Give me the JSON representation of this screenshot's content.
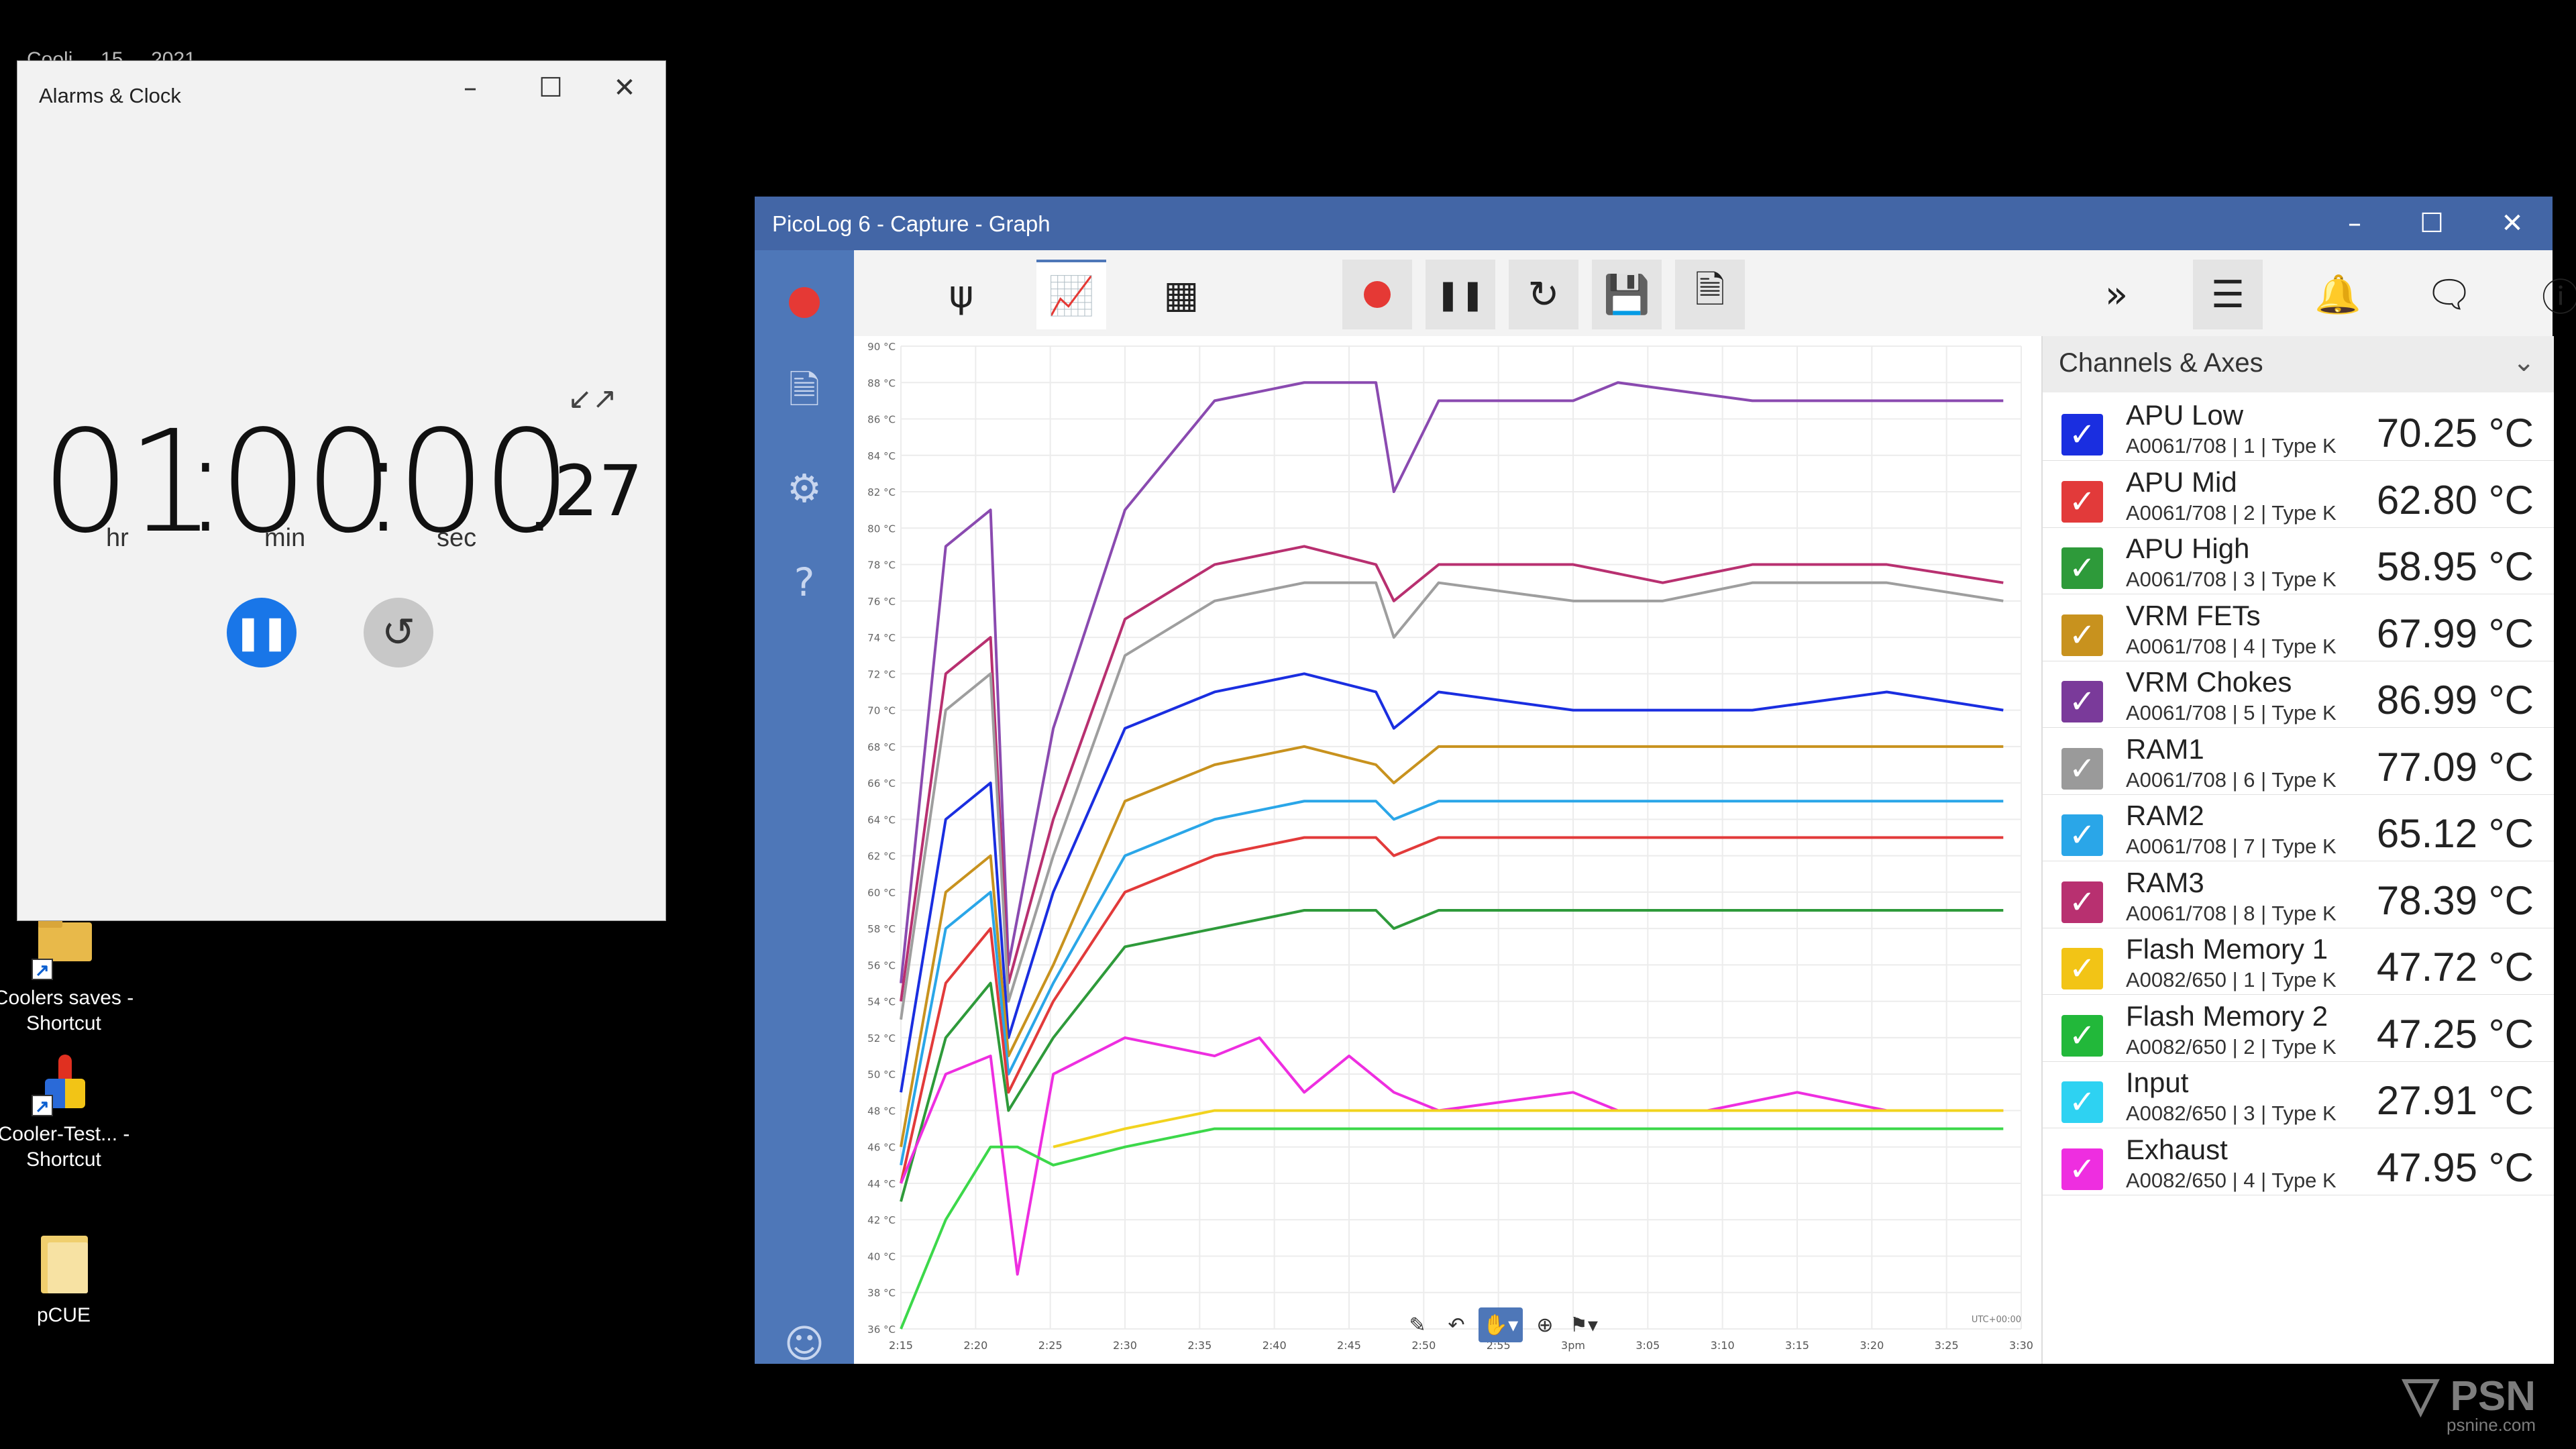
{
  "desktop": {
    "clipped_top_text": "Cooli ... 15 ... 2021",
    "icons": [
      {
        "label": "Coolers saves - Shortcut",
        "icon": "folder-icon"
      },
      {
        "label": "Cooler-Test... - Shortcut",
        "icon": "app-icon"
      },
      {
        "label": "pCUE",
        "icon": "folder-icon"
      }
    ],
    "watermark": "PSN",
    "watermark_sub": "psnine.com"
  },
  "clock": {
    "title": "Alarms & Clock",
    "hours": "01",
    "minutes": "00",
    "seconds": "00",
    "hundredths": "27",
    "sep": ":",
    "dot": ".",
    "unit_hr": "hr",
    "unit_min": "min",
    "unit_sec": "sec"
  },
  "picolog": {
    "title": "PicoLog 6 - Capture - Graph",
    "channels_header": "Channels & Axes",
    "channels": [
      {
        "name": "APU Low",
        "sub": "A0061/708 | 1 | Type K",
        "value": "70.25 °C",
        "color": "#1a2ee0"
      },
      {
        "name": "APU Mid",
        "sub": "A0061/708 | 2 | Type K",
        "value": "62.80 °C",
        "color": "#e23a3a"
      },
      {
        "name": "APU High",
        "sub": "A0061/708 | 3 | Type K",
        "value": "58.95 °C",
        "color": "#2e9a3a"
      },
      {
        "name": "VRM FETs",
        "sub": "A0061/708 | 4 | Type K",
        "value": "67.99 °C",
        "color": "#c8921e"
      },
      {
        "name": "VRM Chokes",
        "sub": "A0061/708 | 5 | Type K",
        "value": "86.99 °C",
        "color": "#7a3a9a"
      },
      {
        "name": "RAM1",
        "sub": "A0061/708 | 6 | Type K",
        "value": "77.09 °C",
        "color": "#9a9a9a"
      },
      {
        "name": "RAM2",
        "sub": "A0061/708 | 7 | Type K",
        "value": "65.12 °C",
        "color": "#2aa6e8"
      },
      {
        "name": "RAM3",
        "sub": "A0061/708 | 8 | Type K",
        "value": "78.39 °C",
        "color": "#b83070"
      },
      {
        "name": "Flash Memory 1",
        "sub": "A0082/650 | 1 | Type K",
        "value": "47.72 °C",
        "color": "#f2c416"
      },
      {
        "name": "Flash Memory 2",
        "sub": "A0082/650 | 2 | Type K",
        "value": "47.25 °C",
        "color": "#22b83a"
      },
      {
        "name": "Input",
        "sub": "A0082/650 | 3 | Type K",
        "value": "27.91 °C",
        "color": "#2ed2f2"
      },
      {
        "name": "Exhaust",
        "sub": "A0082/650 | 4 | Type K",
        "value": "47.95 °C",
        "color": "#ee2ee0"
      }
    ]
  },
  "chart_data": {
    "type": "line",
    "xlabel": "",
    "ylabel": "",
    "x_ticks": [
      "2:15",
      "2:20",
      "2:25",
      "2:30",
      "2:35",
      "2:40",
      "2:45",
      "2:50",
      "2:55",
      "3pm",
      "3:05",
      "3:10",
      "3:15",
      "3:20",
      "3:25",
      "3:30"
    ],
    "y_ticks": [
      "36 °C",
      "38 °C",
      "40 °C",
      "42 °C",
      "44 °C",
      "46 °C",
      "48 °C",
      "50 °C",
      "52 °C",
      "54 °C",
      "56 °C",
      "58 °C",
      "60 °C",
      "62 °C",
      "64 °C",
      "66 °C",
      "68 °C",
      "70 °C",
      "72 °C",
      "74 °C",
      "76 °C",
      "78 °C",
      "80 °C",
      "82 °C",
      "84 °C",
      "86 °C",
      "88 °C",
      "90 °C"
    ],
    "timezone": "UTC+00:00",
    "xlim": [
      2.25,
      3.5
    ],
    "ylim": [
      36,
      90
    ],
    "series": [
      {
        "name": "VRM Chokes",
        "color": "#8a4ab0",
        "points": [
          [
            2.25,
            55
          ],
          [
            2.3,
            79
          ],
          [
            2.35,
            81
          ],
          [
            2.37,
            56
          ],
          [
            2.42,
            69
          ],
          [
            2.5,
            81
          ],
          [
            2.6,
            87
          ],
          [
            2.7,
            88
          ],
          [
            2.78,
            88
          ],
          [
            2.8,
            82
          ],
          [
            2.85,
            87
          ],
          [
            3.0,
            87
          ],
          [
            3.05,
            88
          ],
          [
            3.2,
            87
          ],
          [
            3.35,
            87
          ],
          [
            3.48,
            87
          ]
        ]
      },
      {
        "name": "RAM3",
        "color": "#b83070",
        "points": [
          [
            2.25,
            54
          ],
          [
            2.3,
            72
          ],
          [
            2.35,
            74
          ],
          [
            2.37,
            55
          ],
          [
            2.42,
            64
          ],
          [
            2.5,
            75
          ],
          [
            2.6,
            78
          ],
          [
            2.7,
            79
          ],
          [
            2.78,
            78
          ],
          [
            2.8,
            76
          ],
          [
            2.85,
            78
          ],
          [
            3.0,
            78
          ],
          [
            3.1,
            77
          ],
          [
            3.2,
            78
          ],
          [
            3.35,
            78
          ],
          [
            3.48,
            77
          ]
        ]
      },
      {
        "name": "RAM1",
        "color": "#9e9e9e",
        "points": [
          [
            2.25,
            53
          ],
          [
            2.3,
            70
          ],
          [
            2.35,
            72
          ],
          [
            2.37,
            54
          ],
          [
            2.42,
            62
          ],
          [
            2.5,
            73
          ],
          [
            2.6,
            76
          ],
          [
            2.7,
            77
          ],
          [
            2.78,
            77
          ],
          [
            2.8,
            74
          ],
          [
            2.85,
            77
          ],
          [
            3.0,
            76
          ],
          [
            3.1,
            76
          ],
          [
            3.2,
            77
          ],
          [
            3.35,
            77
          ],
          [
            3.48,
            76
          ]
        ]
      },
      {
        "name": "APU Low",
        "color": "#1a2ee0",
        "points": [
          [
            2.25,
            49
          ],
          [
            2.3,
            64
          ],
          [
            2.35,
            66
          ],
          [
            2.37,
            52
          ],
          [
            2.42,
            60
          ],
          [
            2.5,
            69
          ],
          [
            2.6,
            71
          ],
          [
            2.7,
            72
          ],
          [
            2.78,
            71
          ],
          [
            2.8,
            69
          ],
          [
            2.85,
            71
          ],
          [
            3.0,
            70
          ],
          [
            3.1,
            70
          ],
          [
            3.2,
            70
          ],
          [
            3.35,
            71
          ],
          [
            3.48,
            70
          ]
        ]
      },
      {
        "name": "VRM FETs",
        "color": "#c8921e",
        "points": [
          [
            2.25,
            46
          ],
          [
            2.3,
            60
          ],
          [
            2.35,
            62
          ],
          [
            2.37,
            51
          ],
          [
            2.42,
            56
          ],
          [
            2.5,
            65
          ],
          [
            2.6,
            67
          ],
          [
            2.7,
            68
          ],
          [
            2.78,
            67
          ],
          [
            2.8,
            66
          ],
          [
            2.85,
            68
          ],
          [
            3.0,
            68
          ],
          [
            3.1,
            68
          ],
          [
            3.2,
            68
          ],
          [
            3.35,
            68
          ],
          [
            3.48,
            68
          ]
        ]
      },
      {
        "name": "RAM2",
        "color": "#2aa6e8",
        "points": [
          [
            2.25,
            45
          ],
          [
            2.3,
            58
          ],
          [
            2.35,
            60
          ],
          [
            2.37,
            50
          ],
          [
            2.42,
            55
          ],
          [
            2.5,
            62
          ],
          [
            2.6,
            64
          ],
          [
            2.7,
            65
          ],
          [
            2.78,
            65
          ],
          [
            2.8,
            64
          ],
          [
            2.85,
            65
          ],
          [
            3.0,
            65
          ],
          [
            3.1,
            65
          ],
          [
            3.2,
            65
          ],
          [
            3.35,
            65
          ],
          [
            3.48,
            65
          ]
        ]
      },
      {
        "name": "APU Mid",
        "color": "#e23a3a",
        "points": [
          [
            2.25,
            44
          ],
          [
            2.3,
            55
          ],
          [
            2.35,
            58
          ],
          [
            2.37,
            49
          ],
          [
            2.42,
            54
          ],
          [
            2.5,
            60
          ],
          [
            2.6,
            62
          ],
          [
            2.7,
            63
          ],
          [
            2.78,
            63
          ],
          [
            2.8,
            62
          ],
          [
            2.85,
            63
          ],
          [
            3.0,
            63
          ],
          [
            3.1,
            63
          ],
          [
            3.2,
            63
          ],
          [
            3.35,
            63
          ],
          [
            3.48,
            63
          ]
        ]
      },
      {
        "name": "APU High",
        "color": "#2e9a3a",
        "points": [
          [
            2.25,
            43
          ],
          [
            2.3,
            52
          ],
          [
            2.35,
            55
          ],
          [
            2.37,
            48
          ],
          [
            2.42,
            52
          ],
          [
            2.5,
            57
          ],
          [
            2.6,
            58
          ],
          [
            2.7,
            59
          ],
          [
            2.78,
            59
          ],
          [
            2.8,
            58
          ],
          [
            2.85,
            59
          ],
          [
            3.0,
            59
          ],
          [
            3.1,
            59
          ],
          [
            3.2,
            59
          ],
          [
            3.35,
            59
          ],
          [
            3.48,
            59
          ]
        ]
      },
      {
        "name": "Exhaust",
        "color": "#ee2ee0",
        "points": [
          [
            2.25,
            44
          ],
          [
            2.3,
            50
          ],
          [
            2.35,
            51
          ],
          [
            2.38,
            39
          ],
          [
            2.42,
            50
          ],
          [
            2.5,
            52
          ],
          [
            2.6,
            51
          ],
          [
            2.65,
            52
          ],
          [
            2.7,
            49
          ],
          [
            2.75,
            51
          ],
          [
            2.8,
            49
          ],
          [
            2.85,
            48
          ],
          [
            3.0,
            49
          ],
          [
            3.05,
            48
          ],
          [
            3.15,
            48
          ],
          [
            3.25,
            49
          ],
          [
            3.35,
            48
          ],
          [
            3.48,
            48
          ]
        ]
      },
      {
        "name": "Flash Memory 1",
        "color": "#f2d31e",
        "points": [
          [
            2.42,
            46
          ],
          [
            2.5,
            47
          ],
          [
            2.6,
            48
          ],
          [
            2.7,
            48
          ],
          [
            2.8,
            48
          ],
          [
            3.0,
            48
          ],
          [
            3.1,
            48
          ],
          [
            3.2,
            48
          ],
          [
            3.35,
            48
          ],
          [
            3.48,
            48
          ]
        ]
      },
      {
        "name": "Flash Memory 2",
        "color": "#3cd84a",
        "points": [
          [
            2.25,
            36
          ],
          [
            2.3,
            42
          ],
          [
            2.35,
            46
          ],
          [
            2.38,
            46
          ],
          [
            2.42,
            45
          ],
          [
            2.5,
            46
          ],
          [
            2.6,
            47
          ],
          [
            2.7,
            47
          ],
          [
            2.8,
            47
          ],
          [
            3.0,
            47
          ],
          [
            3.1,
            47
          ],
          [
            3.2,
            47
          ],
          [
            3.35,
            47
          ],
          [
            3.48,
            47
          ]
        ]
      }
    ]
  }
}
